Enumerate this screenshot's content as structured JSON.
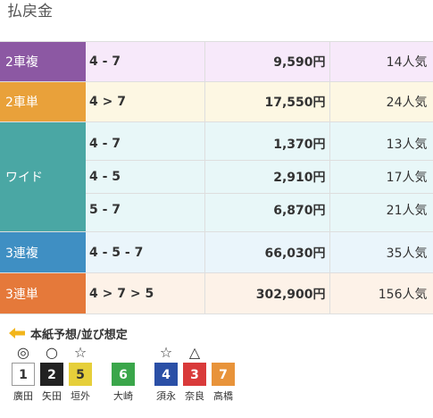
{
  "title": "払戻金",
  "rows": [
    {
      "type": "2車複",
      "combo": "4 - 7",
      "payout": "9,590円",
      "pop": "14人気",
      "color": "#8c58a3",
      "bg": "#f7e9fa"
    },
    {
      "type": "2車単",
      "combo": "4 > 7",
      "payout": "17,550円",
      "pop": "24人気",
      "color": "#e9a13a",
      "bg": "#fdf7e3"
    },
    {
      "type": "ワイド",
      "items": [
        {
          "combo": "4 - 7",
          "payout": "1,370円",
          "pop": "13人気"
        },
        {
          "combo": "4 - 5",
          "payout": "2,910円",
          "pop": "17人気"
        },
        {
          "combo": "5 - 7",
          "payout": "6,870円",
          "pop": "21人気"
        }
      ],
      "color": "#4aa7a4",
      "bg": "#e8f7f8"
    },
    {
      "type": "3連複",
      "combo": "4 - 5 - 7",
      "payout": "66,030円",
      "pop": "35人気",
      "color": "#3f8fc3",
      "bg": "#eaf5fb"
    },
    {
      "type": "3連単",
      "combo": "4 > 7 > 5",
      "payout": "302,900円",
      "pop": "156人気",
      "color": "#e5793a",
      "bg": "#fdf2e8"
    }
  ],
  "prediction": {
    "heading": "本紙予想/並び想定",
    "riders": [
      {
        "mark": "◎",
        "num": "1",
        "name": "廣田",
        "bg": "#ffffff",
        "fg": "#333333",
        "border": "#999999"
      },
      {
        "mark": "○",
        "num": "2",
        "name": "矢田",
        "bg": "#222222",
        "fg": "#ffffff",
        "border": "#222222"
      },
      {
        "mark": "☆",
        "num": "5",
        "name": "垣外",
        "bg": "#e6cf3a",
        "fg": "#333333",
        "border": "#e6cf3a"
      },
      {
        "mark": "",
        "num": "6",
        "name": "大崎",
        "bg": "#3aa64a",
        "fg": "#ffffff",
        "border": "#3aa64a"
      },
      {
        "mark": "☆",
        "num": "4",
        "name": "須永",
        "bg": "#2a4fa6",
        "fg": "#ffffff",
        "border": "#2a4fa6"
      },
      {
        "mark": "△",
        "num": "3",
        "name": "奈良",
        "bg": "#d93a3a",
        "fg": "#ffffff",
        "border": "#d93a3a"
      },
      {
        "mark": "",
        "num": "7",
        "name": "高橋",
        "bg": "#e8933a",
        "fg": "#ffffff",
        "border": "#e8933a"
      }
    ]
  }
}
